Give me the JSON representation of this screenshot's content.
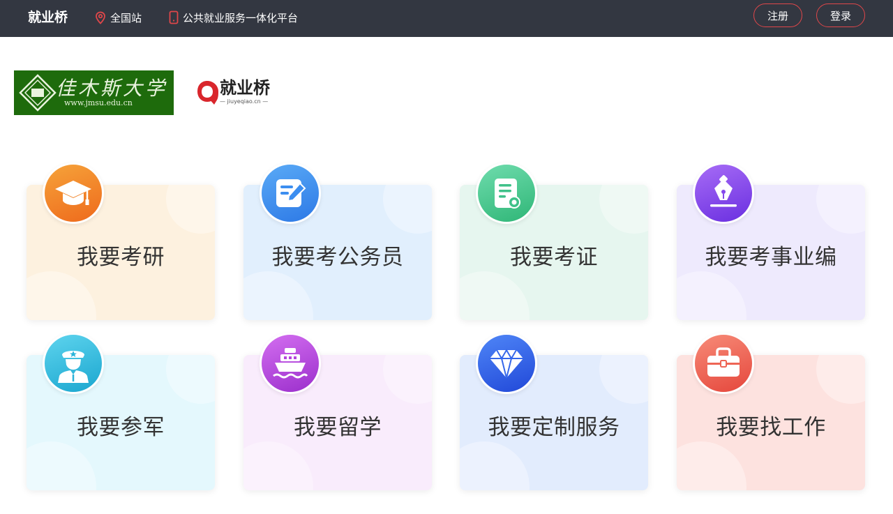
{
  "header": {
    "brand": "就业桥",
    "station": "全国站",
    "platform": "公共就业服务一体化平台",
    "register_label": "注册",
    "login_label": "登录"
  },
  "logos": {
    "university_name": "佳木斯大学",
    "university_url": "www.jmsu.edu.cn",
    "jyq_name": "就业桥",
    "jyq_sub": "jiuyeqiao.cn"
  },
  "cards": [
    {
      "label": "我要考研",
      "icon": "graduation-cap-icon"
    },
    {
      "label": "我要考公务员",
      "icon": "form-edit-icon"
    },
    {
      "label": "我要考证",
      "icon": "certificate-icon"
    },
    {
      "label": "我要考事业编",
      "icon": "pen-nib-icon"
    },
    {
      "label": "我要参军",
      "icon": "soldier-icon"
    },
    {
      "label": "我要留学",
      "icon": "ship-icon"
    },
    {
      "label": "我要定制服务",
      "icon": "diamond-icon"
    },
    {
      "label": "我要找工作",
      "icon": "briefcase-icon"
    }
  ],
  "colors": {
    "topbar": "#333741",
    "accent_red": "#e0474a"
  }
}
